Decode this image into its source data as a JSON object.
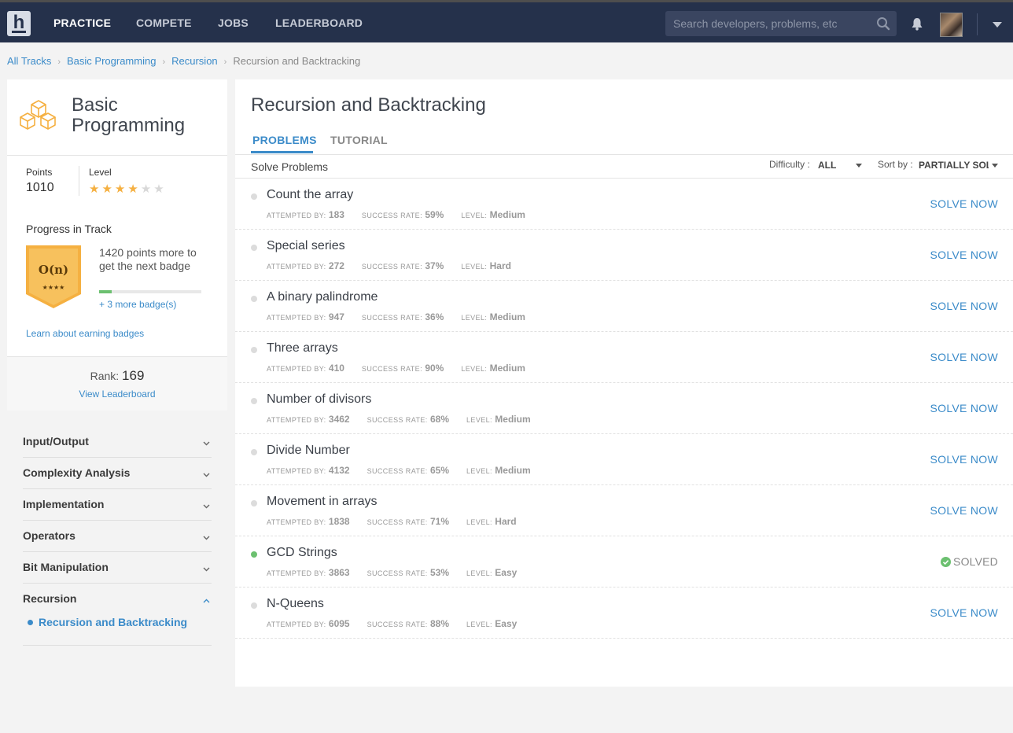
{
  "nav": {
    "logo": "h",
    "links": [
      "PRACTICE",
      "COMPETE",
      "JOBS",
      "LEADERBOARD"
    ],
    "search_placeholder": "Search developers, problems, etc"
  },
  "breadcrumb": [
    "All Tracks",
    "Basic Programming",
    "Recursion",
    "Recursion and Backtracking"
  ],
  "track": {
    "title": "Basic Programming",
    "points_label": "Points",
    "points": "1010",
    "level_label": "Level",
    "level_stars": 4,
    "level_max": 6,
    "progress_title": "Progress in Track",
    "badge_text": "O(n)",
    "badge_stars": "★★★★",
    "points_more": "1420 points more to get the next badge",
    "progress_fraction": 0.12,
    "more_badges": "+ 3 more badge(s)",
    "learn_link": "Learn about earning badges",
    "rank_label": "Rank:",
    "rank": "169",
    "leaderboard_link": "View Leaderboard"
  },
  "topics": [
    {
      "label": "Input/Output",
      "open": false
    },
    {
      "label": "Complexity Analysis",
      "open": false
    },
    {
      "label": "Implementation",
      "open": false
    },
    {
      "label": "Operators",
      "open": false
    },
    {
      "label": "Bit Manipulation",
      "open": false
    },
    {
      "label": "Recursion",
      "open": true,
      "sub": "Recursion and Backtracking"
    }
  ],
  "main": {
    "title": "Recursion and Backtracking",
    "tabs": [
      "PROBLEMS",
      "TUTORIAL"
    ],
    "solve_label": "Solve Problems",
    "difficulty_label": "Difficulty :",
    "difficulty_value": "ALL",
    "sort_label": "Sort by :",
    "sort_value": "PARTIALLY SOLVED"
  },
  "meta_labels": {
    "attempted": "ATTEMPTED BY:",
    "success": "SUCCESS RATE:",
    "level": "LEVEL:"
  },
  "problems": [
    {
      "name": "Count the array",
      "attempted": "183",
      "success": "59%",
      "level": "Medium",
      "status": "SOLVE NOW"
    },
    {
      "name": "Special series",
      "attempted": "272",
      "success": "37%",
      "level": "Hard",
      "status": "SOLVE NOW"
    },
    {
      "name": "A binary palindrome",
      "attempted": "947",
      "success": "36%",
      "level": "Medium",
      "status": "SOLVE NOW"
    },
    {
      "name": "Three arrays",
      "attempted": "410",
      "success": "90%",
      "level": "Medium",
      "status": "SOLVE NOW"
    },
    {
      "name": "Number of divisors",
      "attempted": "3462",
      "success": "68%",
      "level": "Medium",
      "status": "SOLVE NOW"
    },
    {
      "name": "Divide Number",
      "attempted": "4132",
      "success": "65%",
      "level": "Medium",
      "status": "SOLVE NOW"
    },
    {
      "name": "Movement in arrays",
      "attempted": "1838",
      "success": "71%",
      "level": "Hard",
      "status": "SOLVE NOW"
    },
    {
      "name": "GCD Strings",
      "attempted": "3863",
      "success": "53%",
      "level": "Easy",
      "status": "SOLVED"
    },
    {
      "name": "N-Queens",
      "attempted": "6095",
      "success": "88%",
      "level": "Easy",
      "status": "SOLVE NOW"
    }
  ],
  "colors": {
    "nav_bg": "#25314b",
    "accent": "#3b8bc9",
    "solved": "#6cc070",
    "badge": "#f5b041"
  }
}
